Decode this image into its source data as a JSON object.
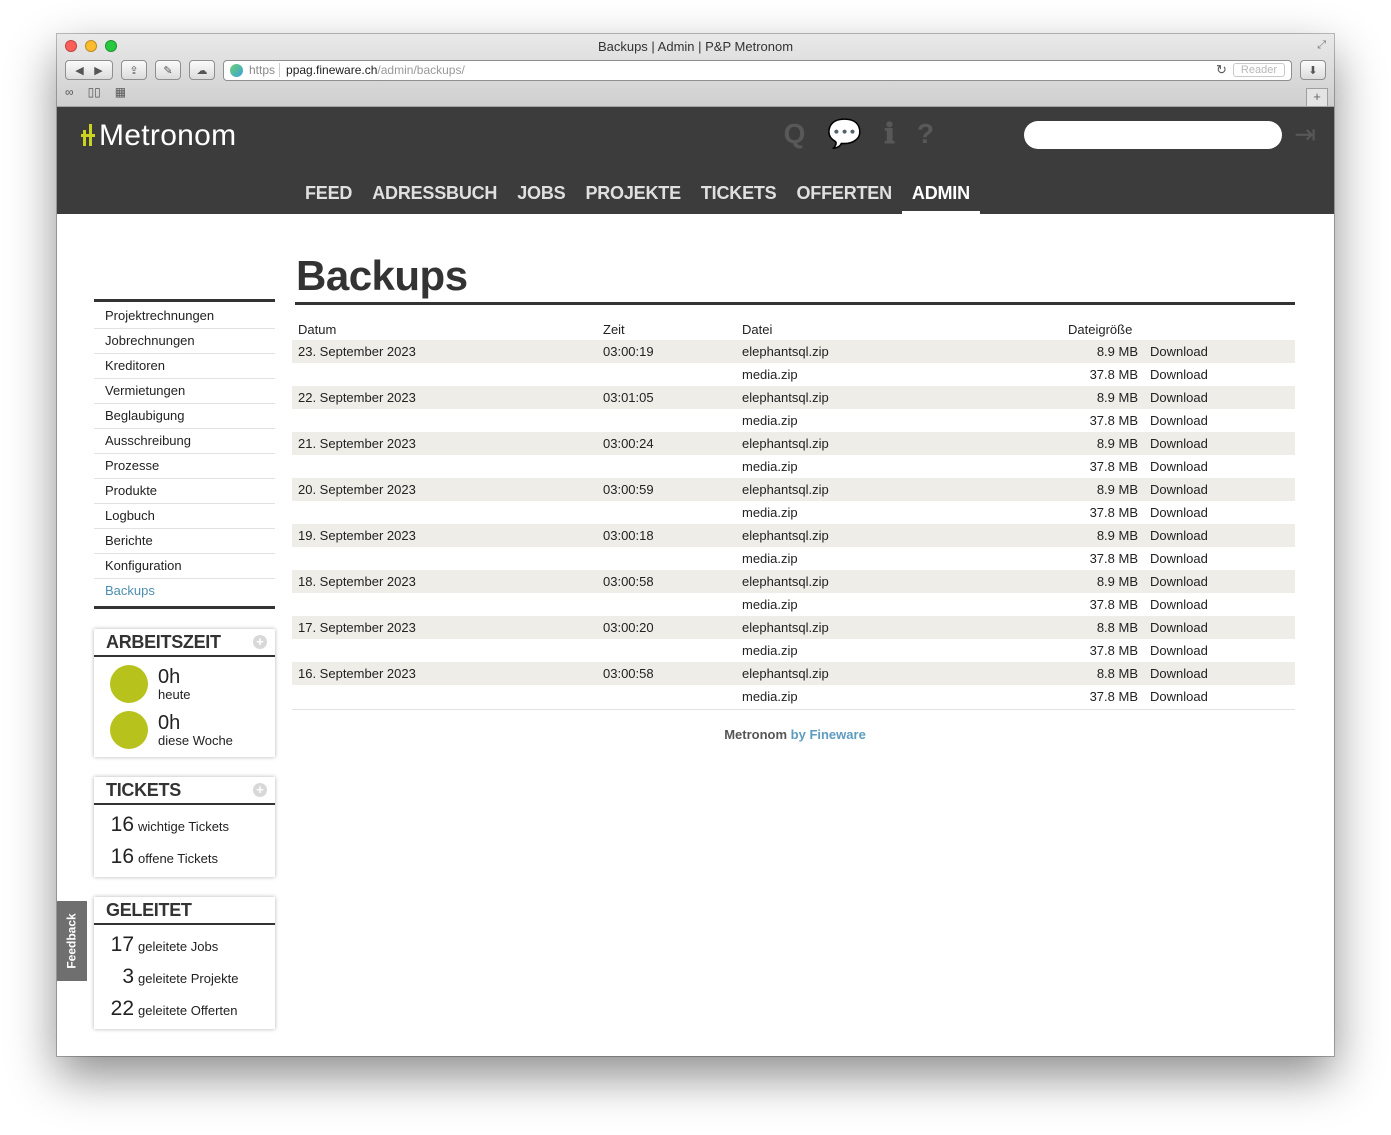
{
  "window": {
    "title": "Backups | Admin | P&P Metronom",
    "url_scheme": "https",
    "url_host": "ppag.fineware.ch",
    "url_path": "/admin/backups/",
    "reader_label": "Reader"
  },
  "app": {
    "name": "Metronom",
    "nav": [
      "FEED",
      "ADRESSBUCH",
      "JOBS",
      "PROJEKTE",
      "TICKETS",
      "OFFERTEN",
      "ADMIN"
    ],
    "active_nav": "ADMIN"
  },
  "sidebar": {
    "menu": [
      "Projektrechnungen",
      "Jobrechnungen",
      "Kreditoren",
      "Vermietungen",
      "Beglaubigung",
      "Ausschreibung",
      "Prozesse",
      "Produkte",
      "Logbuch",
      "Berichte",
      "Konfiguration",
      "Backups"
    ],
    "arbeitszeit": {
      "title": "ARBEITSZEIT",
      "today_value": "0h",
      "today_label": "heute",
      "week_value": "0h",
      "week_label": "diese Woche"
    },
    "tickets": {
      "title": "TICKETS",
      "important_count": "16",
      "important_label": "wichtige Tickets",
      "open_count": "16",
      "open_label": "offene Tickets"
    },
    "geleitet": {
      "title": "GELEITET",
      "jobs_count": "17",
      "jobs_label": "geleitete Jobs",
      "projects_count": "3",
      "projects_label": "geleitete Projekte",
      "offers_count": "22",
      "offers_label": "geleitete Offerten"
    },
    "feedback_label": "Feedback"
  },
  "main": {
    "title": "Backups",
    "columns": [
      "Datum",
      "Zeit",
      "Datei",
      "Dateigröße"
    ],
    "download_label": "Download",
    "rows": [
      {
        "date": "23. September 2023",
        "time": "03:00:19",
        "files": [
          {
            "name": "elephantsql.zip",
            "size": "8.9 MB"
          },
          {
            "name": "media.zip",
            "size": "37.8 MB"
          }
        ]
      },
      {
        "date": "22. September 2023",
        "time": "03:01:05",
        "files": [
          {
            "name": "elephantsql.zip",
            "size": "8.9 MB"
          },
          {
            "name": "media.zip",
            "size": "37.8 MB"
          }
        ]
      },
      {
        "date": "21. September 2023",
        "time": "03:00:24",
        "files": [
          {
            "name": "elephantsql.zip",
            "size": "8.9 MB"
          },
          {
            "name": "media.zip",
            "size": "37.8 MB"
          }
        ]
      },
      {
        "date": "20. September 2023",
        "time": "03:00:59",
        "files": [
          {
            "name": "elephantsql.zip",
            "size": "8.9 MB"
          },
          {
            "name": "media.zip",
            "size": "37.8 MB"
          }
        ]
      },
      {
        "date": "19. September 2023",
        "time": "03:00:18",
        "files": [
          {
            "name": "elephantsql.zip",
            "size": "8.9 MB"
          },
          {
            "name": "media.zip",
            "size": "37.8 MB"
          }
        ]
      },
      {
        "date": "18. September 2023",
        "time": "03:00:58",
        "files": [
          {
            "name": "elephantsql.zip",
            "size": "8.9 MB"
          },
          {
            "name": "media.zip",
            "size": "37.8 MB"
          }
        ]
      },
      {
        "date": "17. September 2023",
        "time": "03:00:20",
        "files": [
          {
            "name": "elephantsql.zip",
            "size": "8.8 MB"
          },
          {
            "name": "media.zip",
            "size": "37.8 MB"
          }
        ]
      },
      {
        "date": "16. September 2023",
        "time": "03:00:58",
        "files": [
          {
            "name": "elephantsql.zip",
            "size": "8.8 MB"
          },
          {
            "name": "media.zip",
            "size": "37.8 MB"
          }
        ]
      }
    ],
    "footer_brand": "Metronom",
    "footer_by": "by Fineware"
  },
  "colors": {
    "header_bg": "#3c3c3c",
    "accent_green": "#b8c21c",
    "link_blue": "#4d8fb0",
    "row_stripe": "#eeede8"
  }
}
